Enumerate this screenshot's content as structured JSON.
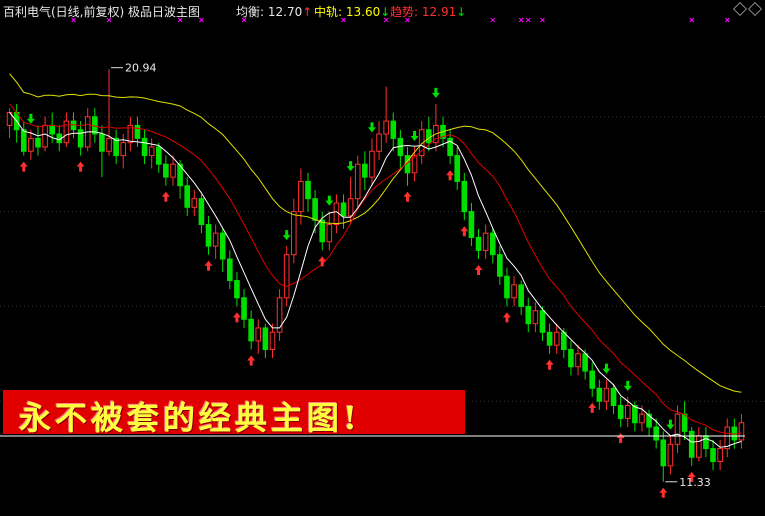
{
  "header": {
    "title": "百利电气(日线,前复权) 极品日波主图",
    "avg_label": "均衡:",
    "avg_value": "12.70",
    "mid_label": "中轨:",
    "mid_value": "13.60",
    "trend_label": "趋势:",
    "trend_value": "12.91"
  },
  "banner": {
    "text": "永不被套的经典主图!"
  },
  "colors": {
    "up": "#ff3030",
    "down": "#00e000",
    "line_white": "#ffffff",
    "line_red": "#e00000",
    "line_yellow": "#e0e000",
    "marker": "#ff00ff"
  },
  "chart_data": {
    "type": "candlestick",
    "ylim": [
      11.0,
      22.0
    ],
    "annotations": [
      {
        "label": "20.94",
        "value": 20.94
      },
      {
        "label": "11.33",
        "value": 11.33
      }
    ],
    "series": [
      {
        "name": "均衡",
        "color": "#ffffff",
        "last": 12.7
      },
      {
        "name": "趋势",
        "color": "#e00000",
        "last": 12.91
      },
      {
        "name": "中轨",
        "color": "#e0e000",
        "last": 13.6
      }
    ],
    "candles": [
      [
        19.6,
        19.9,
        20.0,
        19.3
      ],
      [
        19.9,
        19.5,
        20.1,
        19.2
      ],
      [
        19.5,
        19.0,
        19.7,
        18.9
      ],
      [
        19.0,
        19.3,
        19.5,
        18.8
      ],
      [
        19.3,
        19.1,
        19.6,
        18.9
      ],
      [
        19.1,
        19.6,
        19.8,
        19.0
      ],
      [
        19.6,
        19.4,
        19.9,
        19.2
      ],
      [
        19.4,
        19.2,
        19.6,
        19.0
      ],
      [
        19.2,
        19.7,
        19.9,
        19.1
      ],
      [
        19.7,
        19.5,
        19.9,
        19.3
      ],
      [
        19.5,
        19.1,
        19.7,
        18.9
      ],
      [
        19.1,
        19.8,
        20.0,
        19.0
      ],
      [
        19.8,
        19.4,
        20.0,
        19.2
      ],
      [
        19.4,
        19.0,
        19.6,
        18.4
      ],
      [
        19.0,
        19.3,
        20.9,
        18.9
      ],
      [
        19.3,
        18.9,
        19.5,
        18.7
      ],
      [
        18.9,
        19.2,
        19.4,
        18.6
      ],
      [
        19.2,
        19.6,
        19.8,
        19.0
      ],
      [
        19.6,
        19.3,
        19.8,
        19.1
      ],
      [
        19.3,
        18.9,
        19.5,
        18.7
      ],
      [
        18.9,
        19.1,
        19.3,
        18.6
      ],
      [
        19.1,
        18.7,
        19.2,
        18.5
      ],
      [
        18.7,
        18.4,
        18.9,
        18.2
      ],
      [
        18.4,
        18.7,
        18.9,
        18.2
      ],
      [
        18.7,
        18.2,
        18.8,
        17.9
      ],
      [
        18.2,
        17.7,
        18.4,
        17.5
      ],
      [
        17.7,
        17.9,
        18.1,
        17.5
      ],
      [
        17.9,
        17.3,
        18.0,
        17.1
      ],
      [
        17.3,
        16.8,
        17.5,
        16.6
      ],
      [
        16.8,
        17.1,
        17.3,
        16.5
      ],
      [
        17.1,
        16.5,
        17.2,
        16.2
      ],
      [
        16.5,
        16.0,
        16.7,
        15.8
      ],
      [
        16.0,
        15.6,
        16.2,
        15.4
      ],
      [
        15.6,
        15.1,
        15.8,
        14.9
      ],
      [
        15.1,
        14.6,
        15.3,
        14.4
      ],
      [
        14.6,
        14.9,
        15.1,
        14.3
      ],
      [
        14.9,
        14.4,
        15.0,
        14.2
      ],
      [
        14.4,
        14.8,
        15.0,
        14.2
      ],
      [
        14.8,
        15.6,
        15.8,
        14.6
      ],
      [
        15.6,
        16.6,
        16.8,
        15.4
      ],
      [
        16.6,
        17.6,
        17.9,
        16.4
      ],
      [
        17.6,
        18.3,
        18.6,
        17.3
      ],
      [
        18.3,
        17.9,
        18.5,
        17.6
      ],
      [
        17.9,
        17.4,
        18.1,
        17.1
      ],
      [
        17.4,
        16.9,
        17.6,
        16.7
      ],
      [
        16.9,
        17.3,
        17.6,
        16.7
      ],
      [
        17.3,
        17.8,
        18.0,
        17.1
      ],
      [
        17.8,
        17.5,
        18.0,
        17.2
      ],
      [
        17.5,
        17.9,
        18.4,
        17.3
      ],
      [
        17.9,
        18.7,
        18.9,
        17.7
      ],
      [
        18.7,
        18.4,
        19.0,
        18.1
      ],
      [
        18.4,
        19.0,
        19.3,
        18.2
      ],
      [
        19.0,
        19.4,
        19.7,
        18.8
      ],
      [
        19.4,
        19.7,
        20.5,
        19.2
      ],
      [
        19.7,
        19.3,
        19.9,
        19.0
      ],
      [
        19.3,
        18.9,
        19.5,
        18.6
      ],
      [
        18.9,
        18.5,
        19.1,
        18.2
      ],
      [
        18.5,
        18.9,
        19.1,
        18.3
      ],
      [
        18.9,
        19.5,
        19.7,
        18.7
      ],
      [
        19.5,
        19.2,
        19.8,
        19.0
      ],
      [
        19.2,
        19.6,
        20.1,
        19.0
      ],
      [
        19.6,
        19.3,
        19.8,
        19.1
      ],
      [
        19.3,
        18.9,
        19.5,
        18.7
      ],
      [
        18.9,
        18.3,
        19.1,
        18.1
      ],
      [
        18.3,
        17.6,
        18.5,
        17.4
      ],
      [
        17.6,
        17.0,
        17.8,
        16.8
      ],
      [
        17.0,
        16.7,
        17.2,
        16.5
      ],
      [
        16.7,
        17.1,
        17.3,
        16.5
      ],
      [
        17.1,
        16.6,
        17.2,
        16.4
      ],
      [
        16.6,
        16.1,
        16.8,
        15.9
      ],
      [
        16.1,
        15.6,
        16.3,
        15.4
      ],
      [
        15.6,
        15.9,
        16.1,
        15.4
      ],
      [
        15.9,
        15.4,
        16.0,
        15.2
      ],
      [
        15.4,
        15.0,
        15.6,
        14.8
      ],
      [
        15.0,
        15.3,
        15.5,
        14.8
      ],
      [
        15.3,
        14.8,
        15.4,
        14.6
      ],
      [
        14.8,
        14.5,
        15.0,
        14.3
      ],
      [
        14.5,
        14.8,
        15.0,
        14.3
      ],
      [
        14.8,
        14.4,
        14.9,
        14.2
      ],
      [
        14.4,
        14.0,
        14.6,
        13.8
      ],
      [
        14.0,
        14.3,
        14.5,
        13.8
      ],
      [
        14.3,
        13.9,
        14.4,
        13.7
      ],
      [
        13.9,
        13.5,
        14.1,
        13.3
      ],
      [
        13.5,
        13.2,
        13.7,
        13.0
      ],
      [
        13.2,
        13.5,
        13.7,
        13.0
      ],
      [
        13.5,
        13.1,
        13.6,
        12.9
      ],
      [
        13.1,
        12.8,
        13.3,
        12.6
      ],
      [
        12.8,
        13.1,
        13.3,
        12.6
      ],
      [
        13.1,
        12.7,
        13.2,
        12.5
      ],
      [
        12.7,
        12.9,
        13.1,
        12.5
      ],
      [
        12.9,
        12.6,
        13.0,
        12.4
      ],
      [
        12.6,
        12.3,
        12.8,
        12.1
      ],
      [
        12.3,
        11.7,
        12.5,
        11.33
      ],
      [
        11.7,
        12.2,
        12.4,
        11.5
      ],
      [
        12.2,
        12.9,
        13.1,
        12.0
      ],
      [
        12.9,
        12.5,
        13.2,
        12.3
      ],
      [
        12.5,
        11.9,
        12.6,
        11.7
      ],
      [
        11.9,
        12.4,
        12.6,
        11.8
      ],
      [
        12.4,
        12.1,
        12.6,
        11.9
      ],
      [
        12.1,
        11.8,
        12.3,
        11.6
      ],
      [
        11.8,
        12.1,
        12.3,
        11.6
      ],
      [
        12.1,
        12.6,
        12.8,
        11.9
      ],
      [
        12.6,
        12.3,
        12.8,
        12.1
      ],
      [
        12.3,
        12.7,
        12.9,
        12.1
      ]
    ]
  }
}
